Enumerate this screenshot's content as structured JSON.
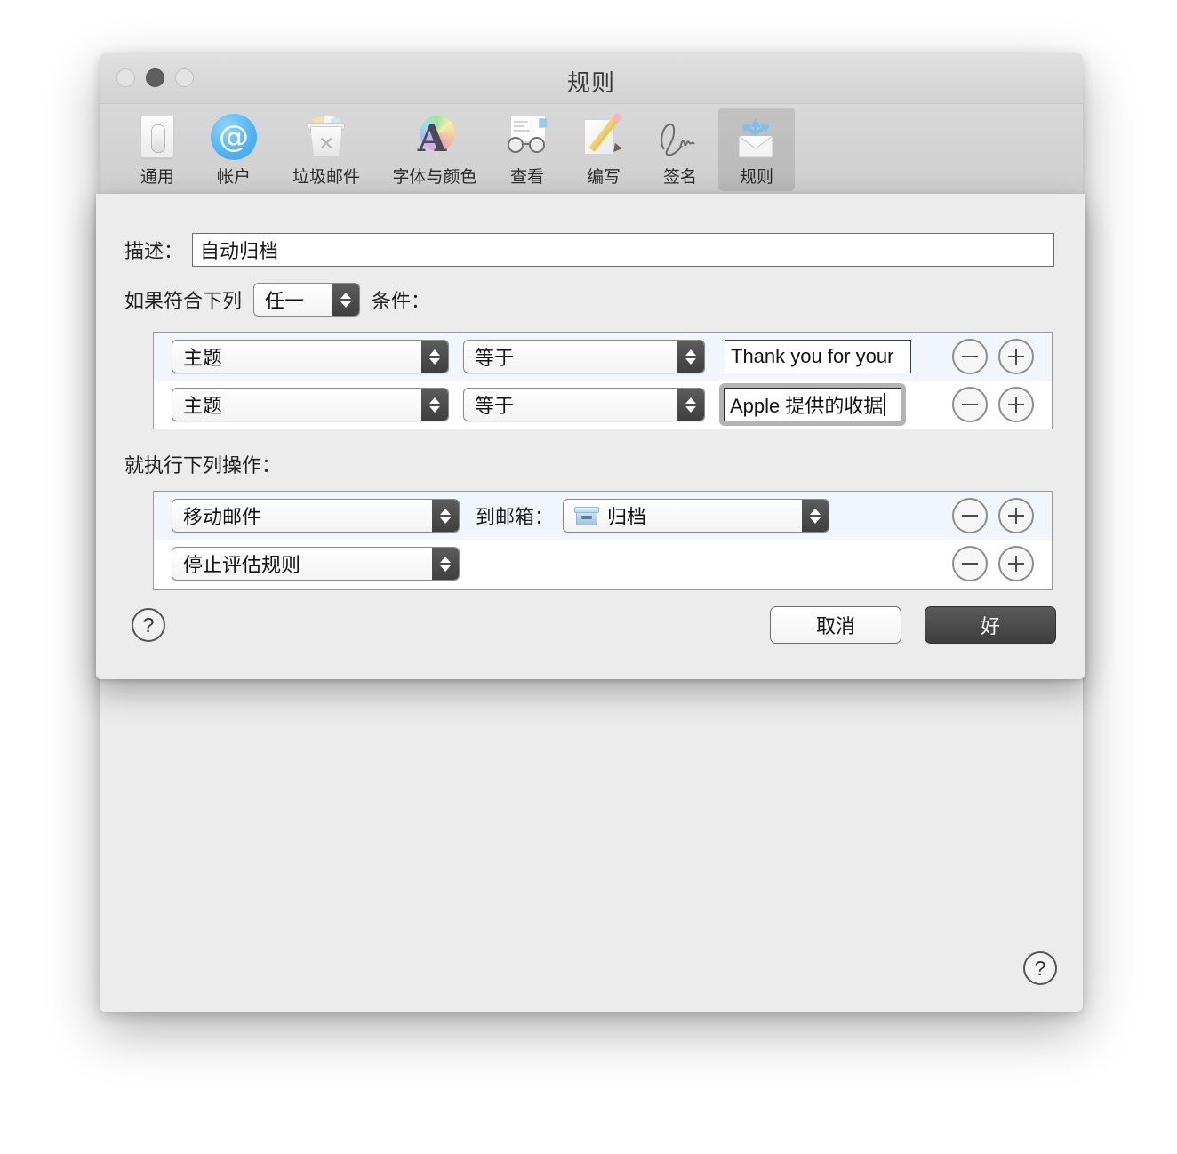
{
  "window": {
    "title": "规则",
    "traffic_lights": [
      "close",
      "minimize",
      "zoom"
    ]
  },
  "toolbar": {
    "items": [
      {
        "label": "通用",
        "icon": "general-switch-icon",
        "selected": false
      },
      {
        "label": "帐户",
        "icon": "at-sign-icon",
        "selected": false
      },
      {
        "label": "垃圾邮件",
        "icon": "trash-can-icon",
        "selected": false
      },
      {
        "label": "字体与颜色",
        "icon": "font-color-wheel-icon",
        "selected": false
      },
      {
        "label": "查看",
        "icon": "envelope-glasses-icon",
        "selected": false
      },
      {
        "label": "编写",
        "icon": "pencil-page-icon",
        "selected": false
      },
      {
        "label": "签名",
        "icon": "signature-icon",
        "selected": false
      },
      {
        "label": "规则",
        "icon": "rules-envelope-arrows-icon",
        "selected": true
      }
    ]
  },
  "sheet": {
    "description": {
      "label": "描述：",
      "value": "自动归档",
      "placeholder": ""
    },
    "match": {
      "prefix_label": "如果符合下列",
      "selector_value": "任一",
      "suffix_label": "条件："
    },
    "conditions": [
      {
        "field": "主题",
        "operator": "等于",
        "value": "Thank you for your",
        "focused": false,
        "tinted": true,
        "remove_label": "−",
        "add_label": "+"
      },
      {
        "field": "主题",
        "operator": "等于",
        "value": "Apple 提供的收据",
        "focused": true,
        "tinted": false,
        "remove_label": "−",
        "add_label": "+"
      }
    ],
    "actions_label": "就执行下列操作：",
    "actions": [
      {
        "action": "移动邮件",
        "target_label": "到邮箱：",
        "target_value": "归档",
        "target_icon": "mailbox-icon",
        "tinted": true,
        "has_target": true
      },
      {
        "action": "停止评估规则",
        "target_label": "",
        "target_value": "",
        "target_icon": "",
        "tinted": false,
        "has_target": false
      }
    ],
    "help_label": "?",
    "cancel_label": "取消",
    "ok_label": "好"
  },
  "background": {
    "help_label": "?"
  },
  "colors": {
    "window_bg": "#ececec",
    "titlebar": "#d6d6d6",
    "toolbar_selected": "rgba(0,0,0,0.10)",
    "row_tint": "#f0f6fc",
    "primary_button": "#4a4a4a",
    "accent_blue": "#4fb3f3"
  }
}
